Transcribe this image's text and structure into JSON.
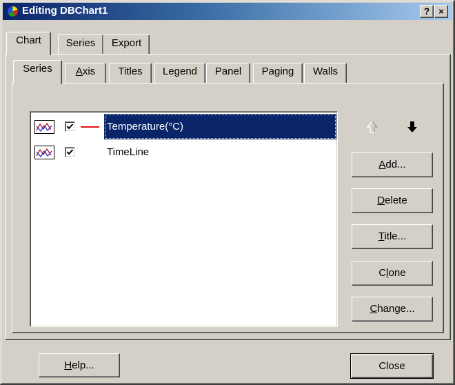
{
  "window": {
    "title": "Editing DBChart1",
    "help_caption": "?",
    "close_caption": "×"
  },
  "main_tabs": [
    {
      "label": "Chart",
      "active": true
    },
    {
      "label": "Series",
      "active": false
    },
    {
      "label": "Export",
      "active": false
    }
  ],
  "chart_tabs": [
    {
      "label": "Series",
      "active": true
    },
    {
      "label": "Axis",
      "mnemonic": "A",
      "rest": "xis"
    },
    {
      "label": "Titles"
    },
    {
      "label": "Legend"
    },
    {
      "label": "Panel"
    },
    {
      "label": "Paging"
    },
    {
      "label": "Walls"
    }
  ],
  "series_list": [
    {
      "name": "Temperature(°C)",
      "checked": true,
      "color": "#e01010",
      "selected": true
    },
    {
      "name": "TimeLine",
      "checked": true,
      "selected": false
    }
  ],
  "buttons": {
    "add": {
      "mn": "A",
      "rest": "dd..."
    },
    "delete": {
      "mn": "D",
      "rest": "elete"
    },
    "title": {
      "mn": "T",
      "rest": "itle..."
    },
    "clone": {
      "pre": "C",
      "mn": "l",
      "rest": "one"
    },
    "change": {
      "mn": "C",
      "rest": "hange..."
    },
    "help": {
      "mn": "H",
      "rest": "elp..."
    },
    "close": "Close"
  },
  "colors": {
    "titlebar_start": "#0a246a",
    "titlebar_end": "#a6caf0",
    "face": "#d4d0c8",
    "selection": "#0a246a",
    "series_line": "#e01010"
  },
  "icons": {
    "app": "chart-app-icon",
    "gallery": "line-chart-gallery-icon",
    "move_up": "arrow-up-icon",
    "move_down": "arrow-down-icon",
    "check": "checkmark-icon"
  }
}
